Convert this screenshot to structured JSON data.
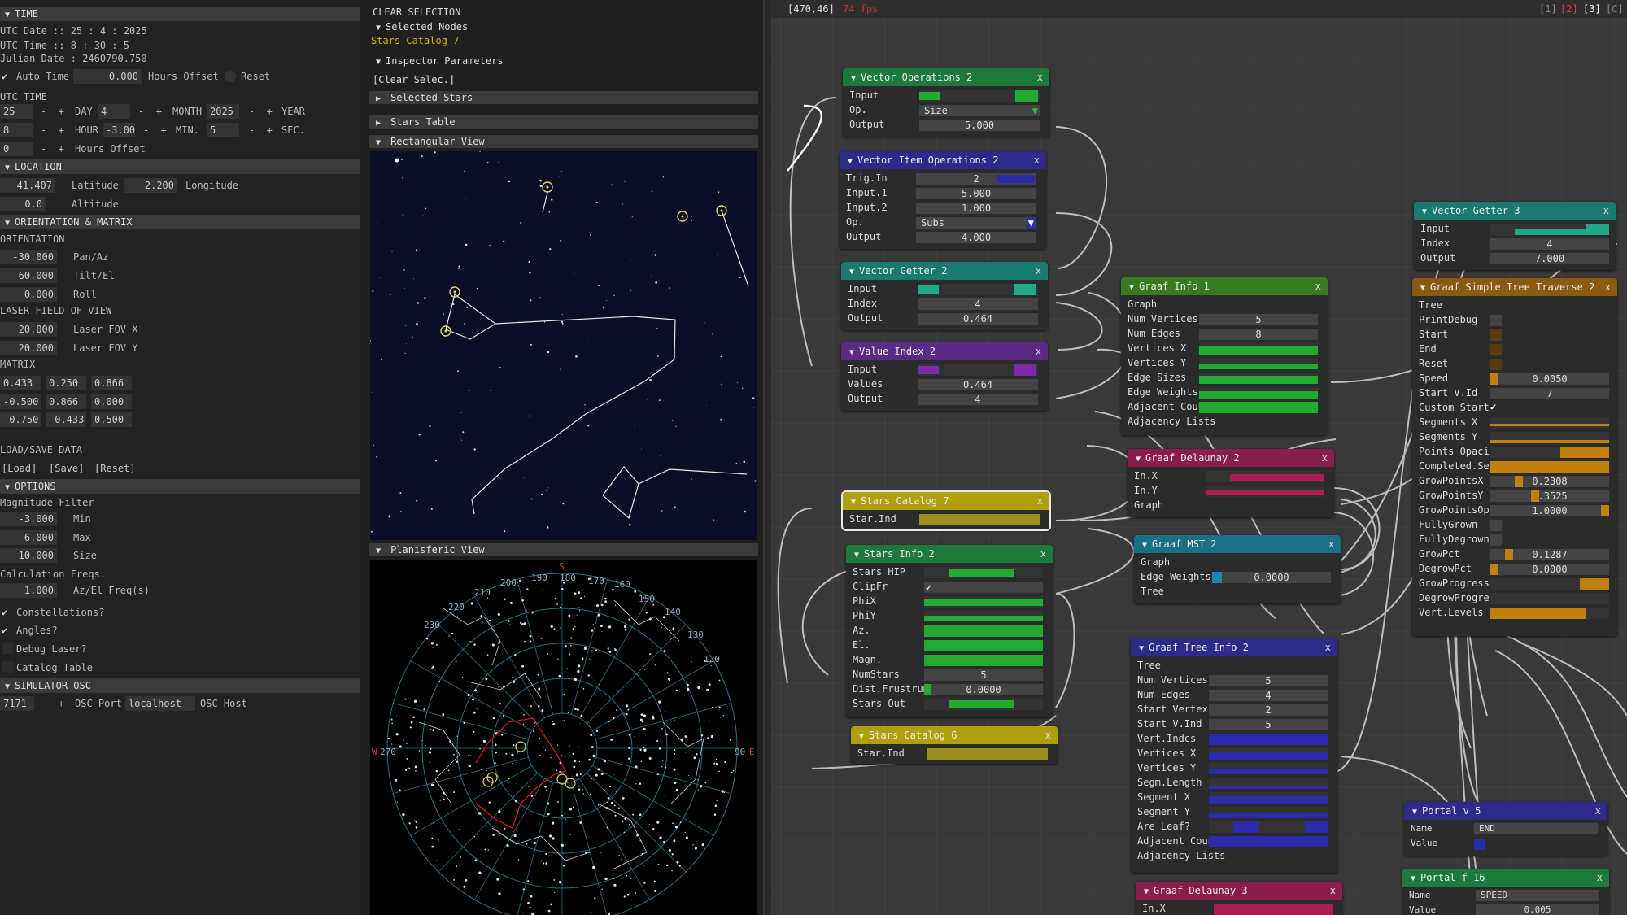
{
  "left": {
    "time_header": "TIME",
    "utc_date": "UTC Date :: 25  : 4  : 2025",
    "utc_time": "UTC Time :: 8  : 30  : 5",
    "julian": "Julian Date : 2460790.750",
    "auto_time": "Auto Time",
    "hours_offset_val": "0.000",
    "hours_offset_label": "Hours Offset",
    "reset": "Reset",
    "utc_time_label": "UTC TIME",
    "day_val": "25",
    "day_label": "DAY",
    "month_val": "4",
    "month_label": "MONTH",
    "year_val": "2025",
    "year_label": "YEAR",
    "hour_val": "8",
    "hour_label": "HOUR",
    "min_val": "-3.000",
    "min_label": "MIN.",
    "sec_val": "5",
    "sec_label": "SEC.",
    "ho_val": "0",
    "ho_label": "Hours Offset",
    "location_header": "LOCATION",
    "lat_val": "41.407",
    "lat_label": "Latitude",
    "lon_val": "2.200",
    "lon_label": "Longitude",
    "alt_val": "0.0",
    "alt_label": "Altitude",
    "orient_header": "ORIENTATION & MATRIX",
    "orientation_label": "ORIENTATION",
    "pan_val": "-30.000",
    "pan_label": "Pan/Az",
    "tilt_val": "60.000",
    "tilt_label": "Tilt/El",
    "roll_val": "0.000",
    "roll_label": "Roll",
    "laser_fov_label": "LASER FIELD OF VIEW",
    "fovx_val": "20.000",
    "fovx_label": "Laser FOV X",
    "fovy_val": "20.000",
    "fovy_label": "Laser FOV Y",
    "matrix_label": "MATRIX",
    "matrix": [
      [
        "0.433",
        "0.250",
        "0.866"
      ],
      [
        "-0.500",
        "0.866",
        "0.000"
      ],
      [
        "-0.750",
        "-0.433",
        "0.500"
      ]
    ],
    "loadsave_label": "LOAD/SAVE DATA",
    "load": "[Load]",
    "save": "[Save]",
    "reset2": "[Reset]",
    "options_header": "OPTIONS",
    "mag_filter": "Magnitude Filter",
    "min_lbl": "Min",
    "max_val": "6.000",
    "max_lbl": "Max",
    "size_val": "10.000",
    "size_lbl": "Size",
    "calc_freqs": "Calculation Freqs.",
    "azel_val": "1.000",
    "azel_lbl": "Az/El Freq(s)",
    "constellations": "Constellations?",
    "angles": "Angles?",
    "debug_laser": "Debug Laser?",
    "catalog_table": "Catalog Table",
    "sim_header": "SIMULATOR OSC",
    "port_val": "7171",
    "port_lbl": "OSC Port",
    "host_val": "localhost",
    "host_lbl": "OSC Host"
  },
  "middle": {
    "clear_selection": "CLEAR SELECTION",
    "selected_nodes": "Selected Nodes",
    "node_name": "Stars_Catalog_7",
    "inspector": "Inspector Parameters",
    "clear_selec": "[Clear Selec.]",
    "selected_stars": "Selected Stars",
    "stars_table": "Stars Table",
    "rect_view": "Rectangular View",
    "plan_view": "Planisferic View",
    "compass": {
      "s": "S",
      "w": "W",
      "e": "E"
    },
    "deg_labels": [
      "190",
      "180",
      "170",
      "160",
      "200",
      "150",
      "210",
      "140",
      "220",
      "130",
      "230",
      "120",
      "270",
      "90"
    ]
  },
  "graph": {
    "coords": "[470,46]",
    "fps": "74 fps",
    "tabs": [
      "[1]",
      "[2]",
      "[3]",
      "[C]"
    ],
    "nodes": {
      "vec_ops2": {
        "title": "Vector Operations 2",
        "r1": "Input",
        "r2": "Op.",
        "r2v": "Size",
        "r3": "Output",
        "r3v": "5.000"
      },
      "vec_item2": {
        "title": "Vector Item Operations 2",
        "r1": "Trig.In",
        "r1v": "2",
        "r2": "Input.1",
        "r2v": "5.000",
        "r3": "Input.2",
        "r3v": "1.000",
        "r4": "Op.",
        "r4v": "Subs",
        "r5": "Output",
        "r5v": "4.000"
      },
      "vec_get2": {
        "title": "Vector Getter 2",
        "r1": "Input",
        "r2": "Index",
        "r2v": "4",
        "r3": "Output",
        "r3v": "0.464"
      },
      "val_idx2": {
        "title": "Value Index 2",
        "r1": "Input",
        "r2": "Values",
        "r2v": "0.464",
        "r3": "Output",
        "r3v": "4"
      },
      "stars_cat7": {
        "title": "Stars Catalog 7",
        "r1": "Star.Ind"
      },
      "stars_info2": {
        "title": "Stars Info 2",
        "rows": [
          "Stars HIP",
          "ClipFr",
          "PhiX",
          "PhiY",
          "Az.",
          "El.",
          "Magn.",
          "NumStars",
          "Dist.Frustrum",
          "Stars Out"
        ],
        "numstars": "5",
        "dist": "0.0000"
      },
      "stars_cat6": {
        "title": "Stars Catalog 6",
        "r1": "Star.Ind"
      },
      "graaf_info1": {
        "title": "Graaf Info 1",
        "rows": [
          "Graph",
          "Num Vertices",
          "Num Edges",
          "Vertices X",
          "Vertices Y",
          "Edge Sizes",
          "Edge Weights",
          "Adjacent Coun",
          "Adjacency Lists"
        ],
        "nv": "5",
        "ne": "8"
      },
      "graaf_del2": {
        "title": "Graaf Delaunay 2",
        "rows": [
          "In.X",
          "In.Y",
          "Graph"
        ]
      },
      "graaf_mst2": {
        "title": "Graaf MST 2",
        "rows": [
          "Graph",
          "Edge Weights",
          "Tree"
        ],
        "ew": "0.0000"
      },
      "graaf_tree2": {
        "title": "Graaf Tree Info 2",
        "rows": [
          "Tree",
          "Num Vertices",
          "Num Edges",
          "Start Vertex",
          "Start V.Ind",
          "Vert.Indcs",
          "Vertices X",
          "Vertices Y",
          "Segm.Length",
          "Segment X",
          "Segment Y",
          "Are Leaf?",
          "Adjacent Coun",
          "Adjacency Lists"
        ],
        "nv": "5",
        "ne": "4",
        "sv": "2",
        "svi": "5"
      },
      "graaf_del3": {
        "title": "Graaf Delaunay 3",
        "rows": [
          "In.X"
        ]
      },
      "vec_get3": {
        "title": "Vector Getter 3",
        "r1": "Input",
        "r2": "Index",
        "r2v": "4",
        "r3": "Output",
        "r3v": "7.000"
      },
      "simple_tree2": {
        "title": "Graaf Simple Tree Traverse 2",
        "rows": [
          "Tree",
          "PrintDebug",
          "Start",
          "End",
          "Reset",
          "Speed",
          "Start V.Id",
          "Custom Start",
          "Segments X",
          "Segments Y",
          "Points Opacity",
          "Completed.Seg",
          "GrowPointsX",
          "GrowPointsY",
          "GrowPointsOp.",
          "FullyGrown",
          "FullyDegrown",
          "GrowPct",
          "DegrowPct",
          "GrowProgress",
          "DegrowProgress",
          "Vert.Levels"
        ],
        "speed": "0.0050",
        "startvid": "7",
        "gpx": "0.2308",
        "gpy": "0.3525",
        "gpo": "1.0000",
        "growpct": "0.1287",
        "degrowpct": "0.0000"
      },
      "portal_v5": {
        "title": "Portal v 5",
        "name_lbl": "Name",
        "name_val": "END",
        "value_lbl": "Value"
      },
      "portal_f16": {
        "title": "Portal f 16",
        "name_lbl": "Name",
        "name_val": "SPEED",
        "value_lbl": "Value",
        "value_val": "0.005"
      }
    }
  },
  "colors": {
    "green": "#1e7a3c",
    "navy": "#2e2a8a",
    "teal": "#1a7a6e",
    "purple": "#5a2a86",
    "yellow": "#b0a010",
    "lime": "#3a7a1e",
    "crimson": "#8a1e4a",
    "cyan": "#1a6e86",
    "orange": "#8a5a10",
    "bar_green": "#22aa33",
    "bar_blue": "#2a2aaa",
    "bar_orange": "#c08010",
    "bar_yellow": "#9a9020"
  },
  "icons": [
    "collapse-triangle-icon",
    "checkbox-check-icon",
    "close-icon",
    "dropdown-arrow-icon",
    "star-marker-icon"
  ]
}
